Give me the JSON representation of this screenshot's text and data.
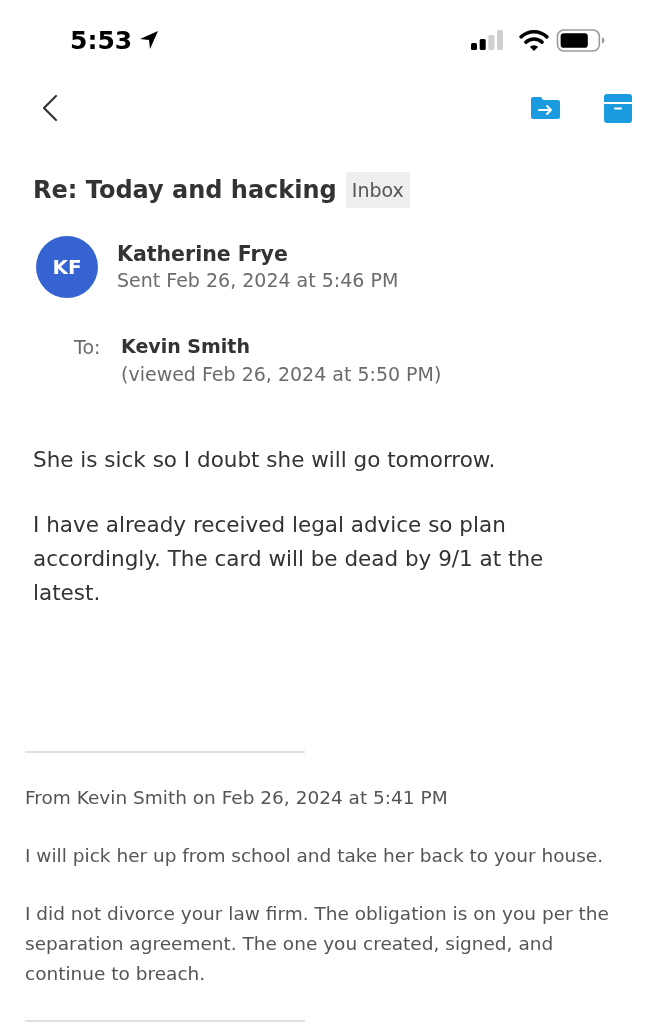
{
  "status_bar": {
    "time": "5:53"
  },
  "email": {
    "subject": "Re: Today and hacking",
    "folder_tag": "Inbox",
    "sender": {
      "initials": "KF",
      "name": "Katherine Frye",
      "sent": "Sent Feb 26, 2024 at 5:46 PM"
    },
    "recipient": {
      "label": "To:",
      "name": "Kevin Smith",
      "viewed": "(viewed Feb 26, 2024 at 5:50 PM)"
    },
    "body": [
      "She is sick so I doubt she will go tomorrow.",
      "I have already received legal advice so plan accordingly. The card will be dead by 9/1 at the latest."
    ]
  },
  "quoted_message": {
    "header": "From Kevin Smith on Feb 26, 2024 at 5:41 PM",
    "body": [
      "I will pick her up from school and take her back to your house.",
      "I did not divorce your law firm. The obligation is on you per the separation agreement. The one you created, signed, and continue to breach."
    ]
  }
}
